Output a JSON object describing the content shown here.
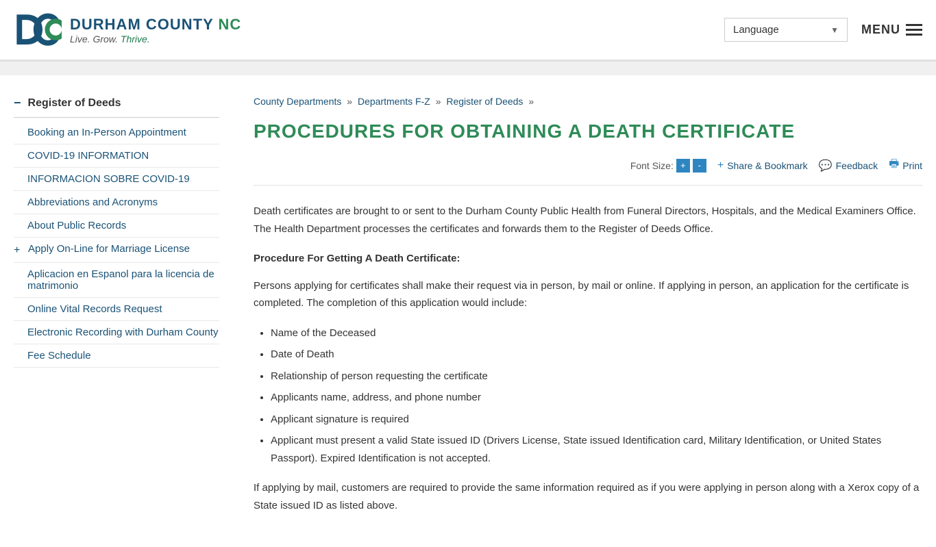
{
  "header": {
    "logo_title": "DURHAM COUNTY",
    "logo_nc": "NC",
    "logo_subtitle_start": "Live. Grow.",
    "logo_subtitle_thrive": "Thrive.",
    "language_label": "Language",
    "menu_label": "MENU"
  },
  "breadcrumb": {
    "items": [
      {
        "label": "County Departments",
        "href": "#"
      },
      {
        "separator": "»"
      },
      {
        "label": "Departments F-Z",
        "href": "#"
      },
      {
        "separator": "»"
      },
      {
        "label": "Register of Deeds",
        "href": "#"
      },
      {
        "separator": "»"
      }
    ]
  },
  "page": {
    "title": "PROCEDURES FOR OBTAINING A DEATH CERTIFICATE",
    "font_size_label": "Font Size:",
    "font_increase": "+",
    "font_decrease": "-",
    "share_label": "Share & Bookmark",
    "feedback_label": "Feedback",
    "print_label": "Print"
  },
  "sidebar": {
    "section_title": "Register of Deeds",
    "nav_items": [
      {
        "label": "Booking an In-Person Appointment",
        "has_plus": false
      },
      {
        "label": "COVID-19 INFORMATION",
        "has_plus": false
      },
      {
        "label": "INFORMACION SOBRE COVID-19",
        "has_plus": false
      },
      {
        "label": "Abbreviations and Acronyms",
        "has_plus": false
      },
      {
        "label": "About Public Records",
        "has_plus": false
      },
      {
        "label": "Apply On-Line for Marriage License",
        "has_plus": true
      },
      {
        "label": "Aplicacion en Espanol para la licencia de matrimonio",
        "has_plus": false
      },
      {
        "label": "Online Vital Records Request",
        "has_plus": false
      },
      {
        "label": "Electronic Recording with Durham County",
        "has_plus": false
      },
      {
        "label": "Fee Schedule",
        "has_plus": false
      }
    ]
  },
  "content": {
    "intro_paragraph": "Death certificates are brought to or sent to the Durham County Public Health from Funeral Directors, Hospitals, and the Medical Examiners Office. The Health Department processes the certificates and forwards them to the Register of Deeds Office.",
    "procedure_heading": "Procedure For Getting A Death Certificate:",
    "procedure_intro": "Persons applying for certificates shall make their request via in person, by mail or online. If applying in person, an application for the certificate is completed. The completion of this application would include:",
    "bullet_items": [
      "Name of the Deceased",
      "Date of Death",
      "Relationship of person requesting the certificate",
      "Applicants name, address, and phone number",
      "Applicant signature is required",
      "Applicant must present a valid State issued ID (Drivers License, State issued Identification card, Military Identification, or United States Passport). Expired Identification is not accepted."
    ],
    "mail_paragraph": "If applying by mail, customers are required to provide the same information required as if you were applying in person along with a Xerox copy of a State issued ID as listed above."
  }
}
